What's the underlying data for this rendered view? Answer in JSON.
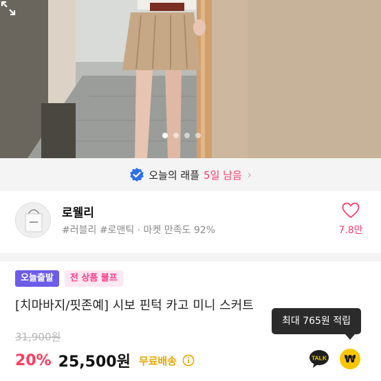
{
  "gallery": {
    "dot_count": 4,
    "active_index": 0,
    "expand_icon": "expand-icon"
  },
  "raffle": {
    "check_icon": "verified-check-icon",
    "label": "오늘의 래플",
    "remaining": "5일 남음",
    "chevron": "›",
    "accent_color": "#ff3b6b"
  },
  "shop": {
    "name": "로웰리",
    "tags": "#러블리 #로맨틱 · 마켓 만족도 92%",
    "like_count": "7.8만",
    "like_icon": "heart-icon"
  },
  "product": {
    "badge_today": "오늘출발",
    "badge_bundle": "전 상품 불프",
    "title": "[치마바지/핏존예] 시보 핀턱 카고 미니 스커트",
    "original_price": "31,900원",
    "discount": "20%",
    "price": "25,500원",
    "shipping": "무료배송",
    "info_icon": "info-icon",
    "talk_label": "TALK",
    "coin_symbol": "₩",
    "tooltip": "최대 765원 적립"
  }
}
